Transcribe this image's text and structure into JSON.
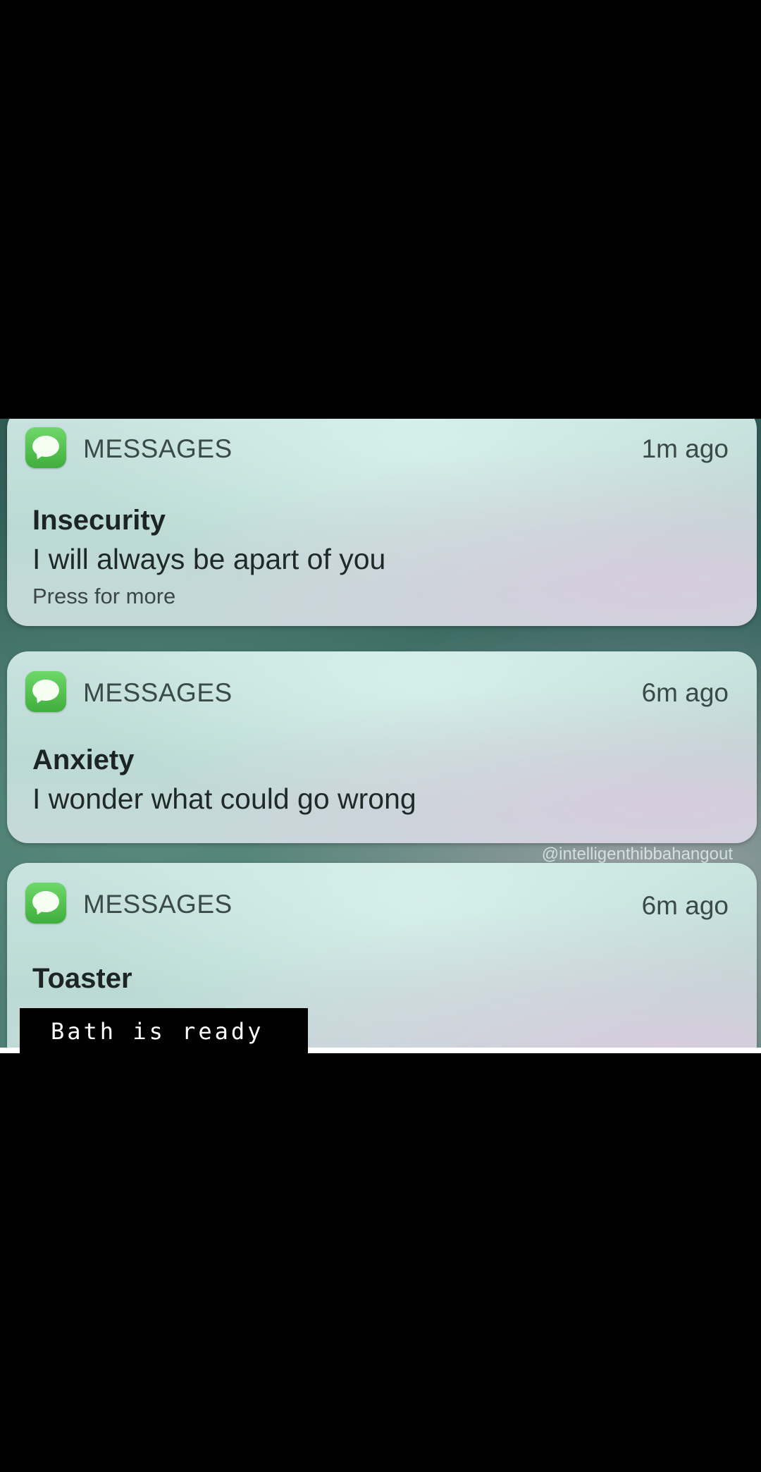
{
  "notifications": [
    {
      "app": "MESSAGES",
      "time": "1m ago",
      "sender": "Insecurity",
      "body": "I will always be apart of you",
      "hint": "Press for more",
      "icon": "messages-app-icon"
    },
    {
      "app": "MESSAGES",
      "time": "6m ago",
      "sender": "Anxiety",
      "body": "I wonder what could go wrong",
      "icon": "messages-app-icon"
    },
    {
      "app": "MESSAGES",
      "time": "6m ago",
      "sender": "Toaster",
      "icon": "messages-app-icon"
    }
  ],
  "watermark": "@intelligenthibbahangout",
  "caption": "Bath is ready",
  "colors": {
    "background": "#000000",
    "icon_green": "#4cc446",
    "card": "#c3dedb"
  }
}
